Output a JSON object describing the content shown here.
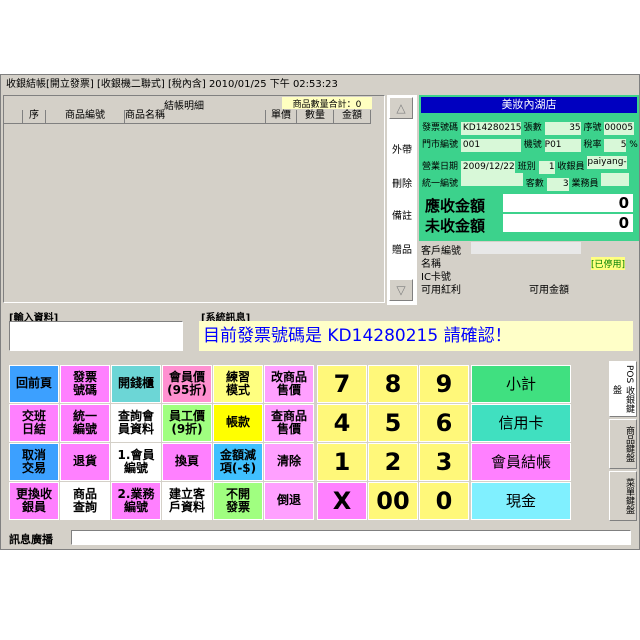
{
  "title": "收銀結帳[開立發票] [收銀機二聯式] [稅內含]  2010/01/25  下午 02:53:23",
  "grid": {
    "section_title": "結帳明細",
    "qty_total_label": "商品數量合計：0",
    "columns": [
      "序",
      "商品編號",
      "商品名稱",
      "單價",
      "數量",
      "金額"
    ]
  },
  "side_buttons": [
    "外帶",
    "刪除",
    "備註",
    "贈品"
  ],
  "store": {
    "name": "美妝內湖店",
    "fields": {
      "invoice_no_label": "發票號碼",
      "invoice_no": "KD14280215",
      "sheets_label": "張數",
      "sheets": "35",
      "seq_label": "序號",
      "seq": "00005",
      "store_code_label": "門市編號",
      "store_code": "001",
      "machine_label": "機號",
      "machine": "P01",
      "tax_label": "稅率",
      "tax": "5",
      "tax_unit": "%",
      "biz_date_label": "營業日期",
      "biz_date": "2009/12/22",
      "shift_label": "班別",
      "shift": "1",
      "cashier_label": "收銀員",
      "cashier": "paiyang-hi",
      "unified_no_label": "統一編號",
      "customers_label": "客數",
      "customers": "3",
      "staff_label": "業務員"
    },
    "receivable_label": "應收金額",
    "receivable": "0",
    "outstanding_label": "未收金額",
    "outstanding": "0",
    "cust_no_label": "客戶編號",
    "name_label": "名稱",
    "disabled_label": "[已停用]",
    "ic_label": "IC卡號",
    "bonus_label": "可用紅利",
    "avail_amount_label": "可用金額"
  },
  "input_section": {
    "title": "[輸入資料]"
  },
  "sysmsg": {
    "title": "[系統訊息]",
    "message": "目前發票號碼是 KD14280215 請確認！"
  },
  "function_keys": [
    [
      "回前頁",
      "發票\n號碼",
      "開錢櫃",
      "會員價\n(95折)",
      "練習\n模式",
      "改商品\n售價"
    ],
    [
      "交班\n日結",
      "統一\n編號",
      "查詢會\n員資料",
      "員工價\n(9折)",
      "帳款",
      "查商品\n售價"
    ],
    [
      "取消\n交易",
      "退貨",
      "1.會員\n編號",
      "換頁",
      "金額減\n項(-$)",
      "清除"
    ],
    [
      "更換收\n銀員",
      "商品\n查詢",
      "2.業務\n編號",
      "建立客\n戶資料",
      "不開\n發票",
      "倒退"
    ]
  ],
  "numpad": [
    [
      "7",
      "8",
      "9"
    ],
    [
      "4",
      "5",
      "6"
    ],
    [
      "1",
      "2",
      "3"
    ],
    [
      "X",
      "00",
      "0"
    ]
  ],
  "action_keys": [
    "小計",
    "信用卡",
    "會員結帳",
    "現金"
  ],
  "tabs": [
    "POS\n收銀鍵盤",
    "商品鍵盤",
    "菜單鍵盤"
  ],
  "status_bar": {
    "label": "訊息廣播"
  },
  "colors": {
    "info_green": "#3cd28c",
    "title_blue": "#0000c0",
    "msg_blue": "#0000ff",
    "numpad_yellow": "#fff87a"
  }
}
